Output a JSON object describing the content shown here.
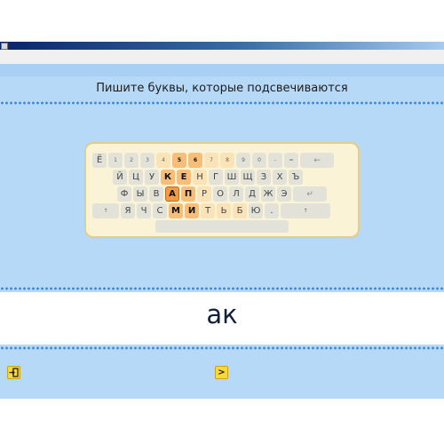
{
  "instruction": "Пишите буквы, которые подсвечиваются",
  "typed_text": "ак",
  "keyboard": {
    "row1": [
      {
        "t": "Ё",
        "c": "key"
      },
      {
        "t": "1",
        "c": "key s"
      },
      {
        "t": "2",
        "c": "key s"
      },
      {
        "t": "3",
        "c": "key s"
      },
      {
        "t": "4",
        "c": "key s warm"
      },
      {
        "t": "5",
        "c": "key s active"
      },
      {
        "t": "6",
        "c": "key s active"
      },
      {
        "t": "7",
        "c": "key s warm"
      },
      {
        "t": "8",
        "c": "key s warm"
      },
      {
        "t": "9",
        "c": "key s"
      },
      {
        "t": "0",
        "c": "key s"
      },
      {
        "t": "-",
        "c": "key s"
      },
      {
        "t": "=",
        "c": "key s"
      },
      {
        "t": "←",
        "c": "key m"
      }
    ],
    "row2": [
      {
        "t": "Й",
        "c": "key"
      },
      {
        "t": "Ц",
        "c": "key"
      },
      {
        "t": "У",
        "c": "key"
      },
      {
        "t": "К",
        "c": "key active"
      },
      {
        "t": "Е",
        "c": "key active"
      },
      {
        "t": "Н",
        "c": "key warm"
      },
      {
        "t": "Г",
        "c": "key"
      },
      {
        "t": "Ш",
        "c": "key"
      },
      {
        "t": "Щ",
        "c": "key"
      },
      {
        "t": "З",
        "c": "key"
      },
      {
        "t": "Х",
        "c": "key"
      },
      {
        "t": "Ъ",
        "c": "key"
      }
    ],
    "row3": [
      {
        "t": "Ф",
        "c": "key"
      },
      {
        "t": "Ы",
        "c": "key"
      },
      {
        "t": "В",
        "c": "key"
      },
      {
        "t": "А",
        "c": "key hl"
      },
      {
        "t": "П",
        "c": "key active"
      },
      {
        "t": "Р",
        "c": "key warm"
      },
      {
        "t": "О",
        "c": "key"
      },
      {
        "t": "Л",
        "c": "key"
      },
      {
        "t": "Д",
        "c": "key"
      },
      {
        "t": "Ж",
        "c": "key"
      },
      {
        "t": "Э",
        "c": "key"
      },
      {
        "t": "↵",
        "c": "key m"
      }
    ],
    "row4": [
      {
        "t": "↑",
        "c": "key s"
      },
      {
        "t": "Я",
        "c": "key"
      },
      {
        "t": "Ч",
        "c": "key"
      },
      {
        "t": "С",
        "c": "key"
      },
      {
        "t": "М",
        "c": "key active"
      },
      {
        "t": "И",
        "c": "key active"
      },
      {
        "t": "Т",
        "c": "key warm"
      },
      {
        "t": "Ь",
        "c": "key warm"
      },
      {
        "t": "Б",
        "c": "key warm"
      },
      {
        "t": "Ю",
        "c": "key"
      },
      {
        "t": ".",
        "c": "key"
      },
      {
        "t": "↑",
        "c": "key s"
      }
    ]
  },
  "buttons": {
    "next_label": ">"
  },
  "icons": {
    "exit": "exit-door-icon",
    "next": "next-arrow-icon"
  },
  "colors": {
    "panel": "#b7d9f8",
    "highlight": "#f39a43",
    "button": "#fbd83a"
  }
}
